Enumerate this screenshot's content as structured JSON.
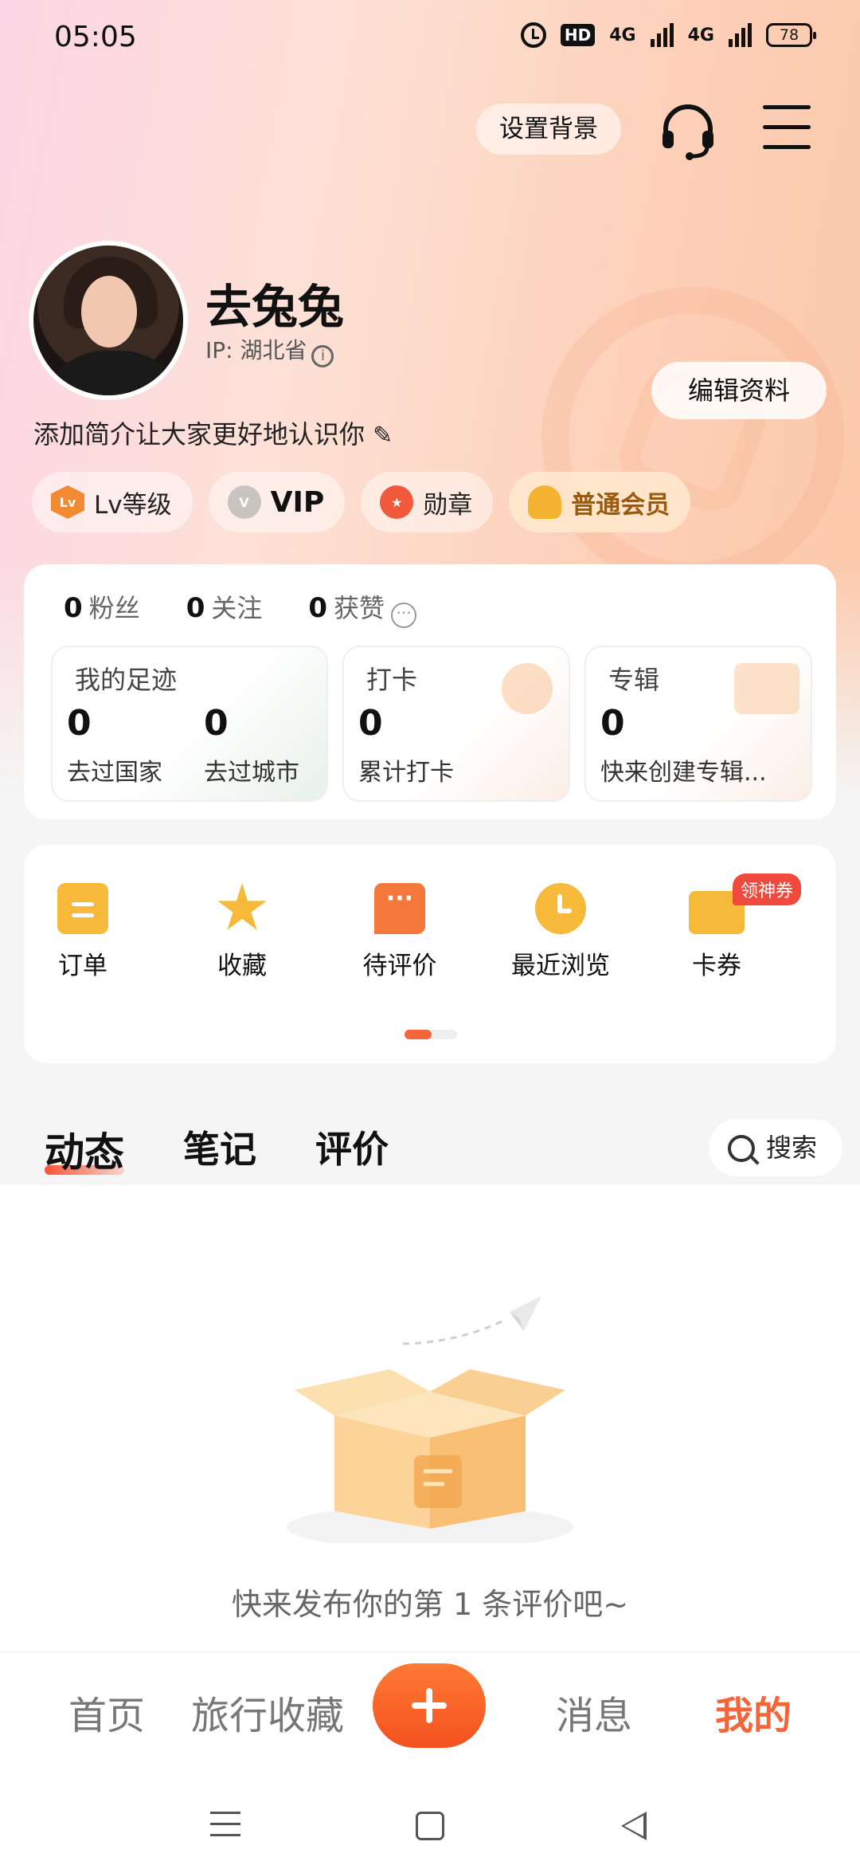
{
  "status_bar": {
    "time": "05:05",
    "hd_label": "HD",
    "network1": "4G",
    "network2": "4G",
    "battery": "78"
  },
  "header": {
    "set_background_label": "设置背景",
    "headset_icon": "headset-icon",
    "menu_icon": "menu-icon"
  },
  "profile": {
    "name": "去兔兔",
    "ip_label": "IP: 湖北省",
    "edit_button": "编辑资料",
    "bio_placeholder": "添加简介让大家更好地认识你"
  },
  "badges": [
    {
      "icon_text": "Lv",
      "label": "Lv等级"
    },
    {
      "icon_text": "V",
      "label": "VIP"
    },
    {
      "icon_text": "★",
      "label": "勋章"
    },
    {
      "icon_text": "",
      "label": "普通会员"
    }
  ],
  "stats": {
    "fans_count": "0",
    "fans_label": "粉丝",
    "follow_count": "0",
    "follow_label": "关注",
    "likes_count": "0",
    "likes_label": "获赞"
  },
  "cards": {
    "footprint": {
      "title": "我的足迹",
      "countries_value": "0",
      "countries_label": "去过国家",
      "cities_value": "0",
      "cities_label": "去过城市"
    },
    "checkin": {
      "title": "打卡",
      "value": "0",
      "label": "累计打卡"
    },
    "album": {
      "title": "专辑",
      "value": "0",
      "label": "快来创建专辑..."
    }
  },
  "shortcuts": [
    {
      "label": "订单",
      "icon": "order-icon"
    },
    {
      "label": "收藏",
      "icon": "star-icon"
    },
    {
      "label": "待评价",
      "icon": "comment-icon"
    },
    {
      "label": "最近浏览",
      "icon": "clock-icon"
    },
    {
      "label": "卡券",
      "icon": "coupon-icon"
    }
  ],
  "coupon_tag": "领神券",
  "content_tabs": [
    "动态",
    "笔记",
    "评价"
  ],
  "search_label": "搜索",
  "empty_message": "快来发布你的第 1 条评价吧~",
  "bottom_nav": {
    "home": "首页",
    "travel_collection": "旅行收藏",
    "messages": "消息",
    "mine": "我的"
  },
  "colors": {
    "accent": "#f4663a",
    "coupon_tag": "#f04a3e",
    "icon_yellow": "#f6b93a"
  }
}
